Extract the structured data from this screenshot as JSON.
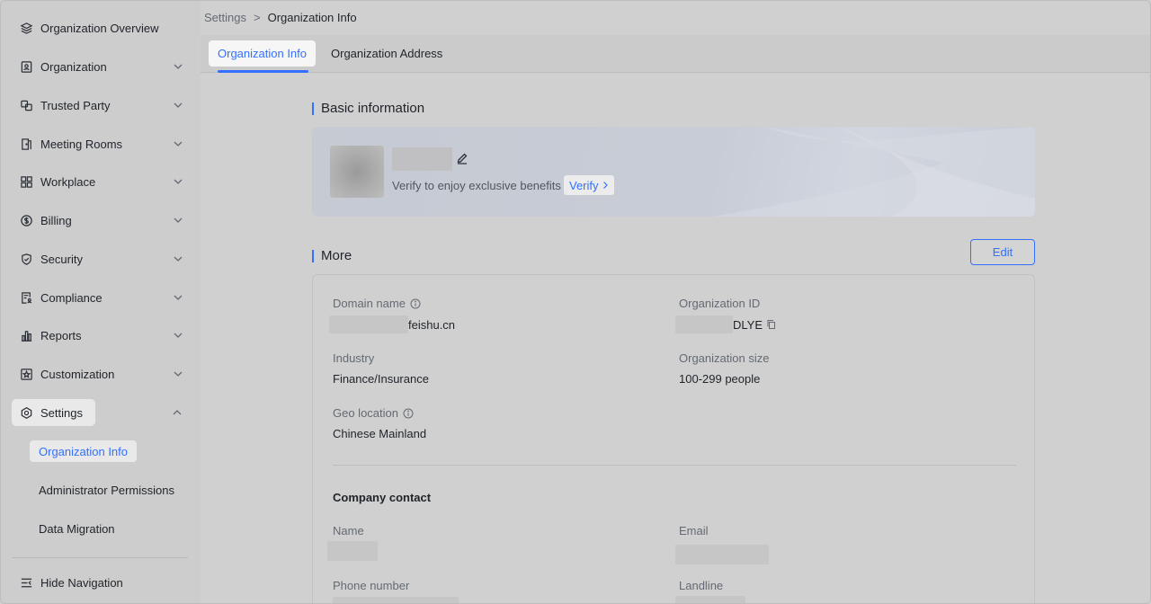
{
  "sidebar": {
    "items": [
      {
        "label": "Organization Overview",
        "icon": "layers-icon"
      },
      {
        "label": "Organization",
        "icon": "contact-book-icon"
      },
      {
        "label": "Trusted Party",
        "icon": "link-squares-icon"
      },
      {
        "label": "Meeting Rooms",
        "icon": "door-icon"
      },
      {
        "label": "Workplace",
        "icon": "grid-icon"
      },
      {
        "label": "Billing",
        "icon": "dollar-icon"
      },
      {
        "label": "Security",
        "icon": "shield-icon"
      },
      {
        "label": "Compliance",
        "icon": "document-person-icon"
      },
      {
        "label": "Reports",
        "icon": "bar-chart-icon"
      },
      {
        "label": "Customization",
        "icon": "star-box-icon"
      },
      {
        "label": "Settings",
        "icon": "gear-hexagon-icon"
      }
    ],
    "settings_children": [
      "Organization Info",
      "Administrator Permissions",
      "Data Migration"
    ],
    "hide_nav_label": "Hide Navigation"
  },
  "breadcrumb": {
    "parent": "Settings",
    "separator": ">",
    "current": "Organization Info"
  },
  "tabs": [
    "Organization Info",
    "Organization Address"
  ],
  "basic": {
    "title": "Basic information",
    "verify_text": "Verify to enjoy exclusive benefits",
    "verify_button": "Verify"
  },
  "more": {
    "title": "More",
    "edit_button": "Edit",
    "domain_label": "Domain name",
    "domain_value": "feishu.cn",
    "org_id_label": "Organization ID",
    "org_id_value": "DLYE",
    "industry_label": "Industry",
    "industry_value": "Finance/Insurance",
    "org_size_label": "Organization size",
    "org_size_value": "100-299 people",
    "geo_label": "Geo location",
    "geo_value": "Chinese Mainland",
    "company_contact": "Company contact",
    "name_label": "Name",
    "email_label": "Email",
    "phone_label": "Phone number",
    "landline_label": "Landline"
  },
  "colors": {
    "accent": "#3370ff",
    "text": "#1f2329",
    "muted": "#646a73"
  }
}
